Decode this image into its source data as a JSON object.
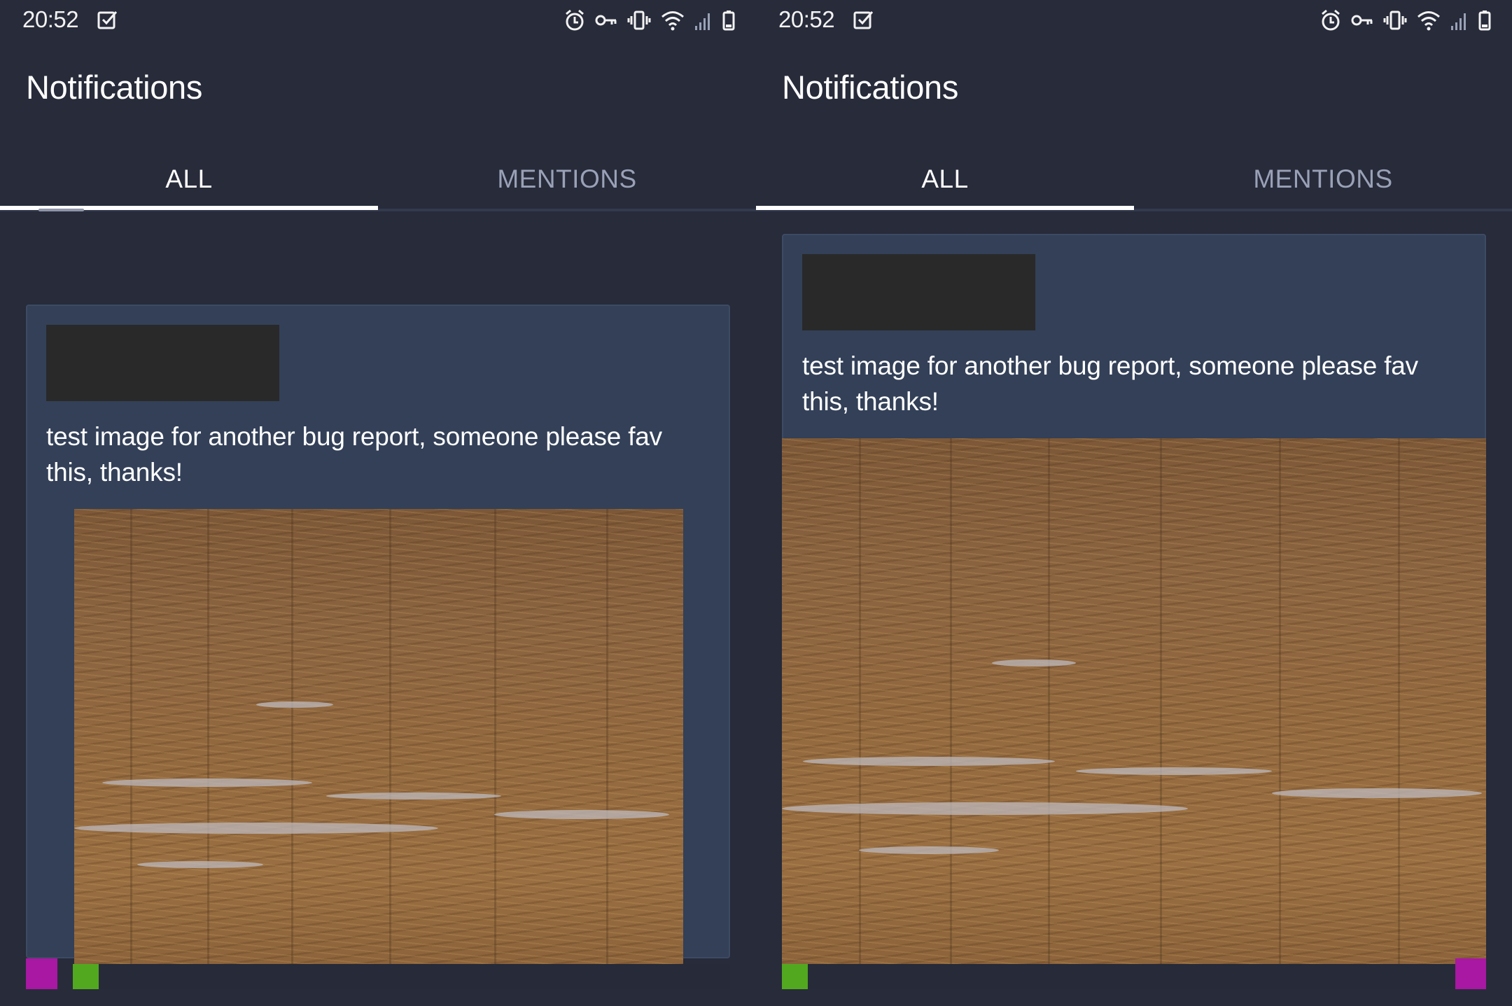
{
  "status_bar": {
    "time": "20:52"
  },
  "header": {
    "title": "Notifications"
  },
  "tabs": [
    {
      "label": "ALL",
      "selected": true
    },
    {
      "label": "MENTIONS",
      "selected": false
    }
  ],
  "notification": {
    "text": "test image for another bug report, someone please fav this, thanks!"
  },
  "colors": {
    "background": "#272b3a",
    "card": "#334058",
    "tab_active": "#ffffff",
    "tab_inactive": "#9aa1b7",
    "magenta_marker": "#a818a2",
    "green_marker": "#52a81e"
  },
  "icons": [
    "checkbox-icon",
    "alarm-icon",
    "vpn-key-icon",
    "vibrate-icon",
    "wifi-icon",
    "signal-icon",
    "battery-icon"
  ]
}
